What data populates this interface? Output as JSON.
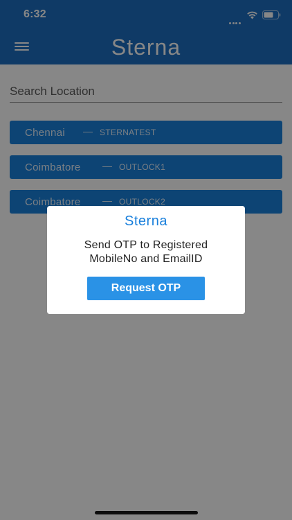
{
  "status_bar": {
    "time": "6:32"
  },
  "header": {
    "brand": "Sterna"
  },
  "search": {
    "placeholder": "Search Location"
  },
  "locations": [
    {
      "city": "Chennai",
      "dash": "—",
      "code": "STERNATEST"
    },
    {
      "city": "Coimbatore",
      "dash": "—",
      "code": "OUTLOCK1"
    },
    {
      "city": "Coimbatore",
      "dash": "—",
      "code": "OUTLOCK2"
    }
  ],
  "dialog": {
    "title": "Sterna",
    "message_line1": "Send OTP to Registered",
    "message_line2": "MobileNo and EmailID",
    "button_label": "Request OTP"
  },
  "colors": {
    "header": "#1d6fc0",
    "location_row": "#1a80dc",
    "dialog_title": "#1a80dc",
    "otp_button": "#2a92e6"
  }
}
